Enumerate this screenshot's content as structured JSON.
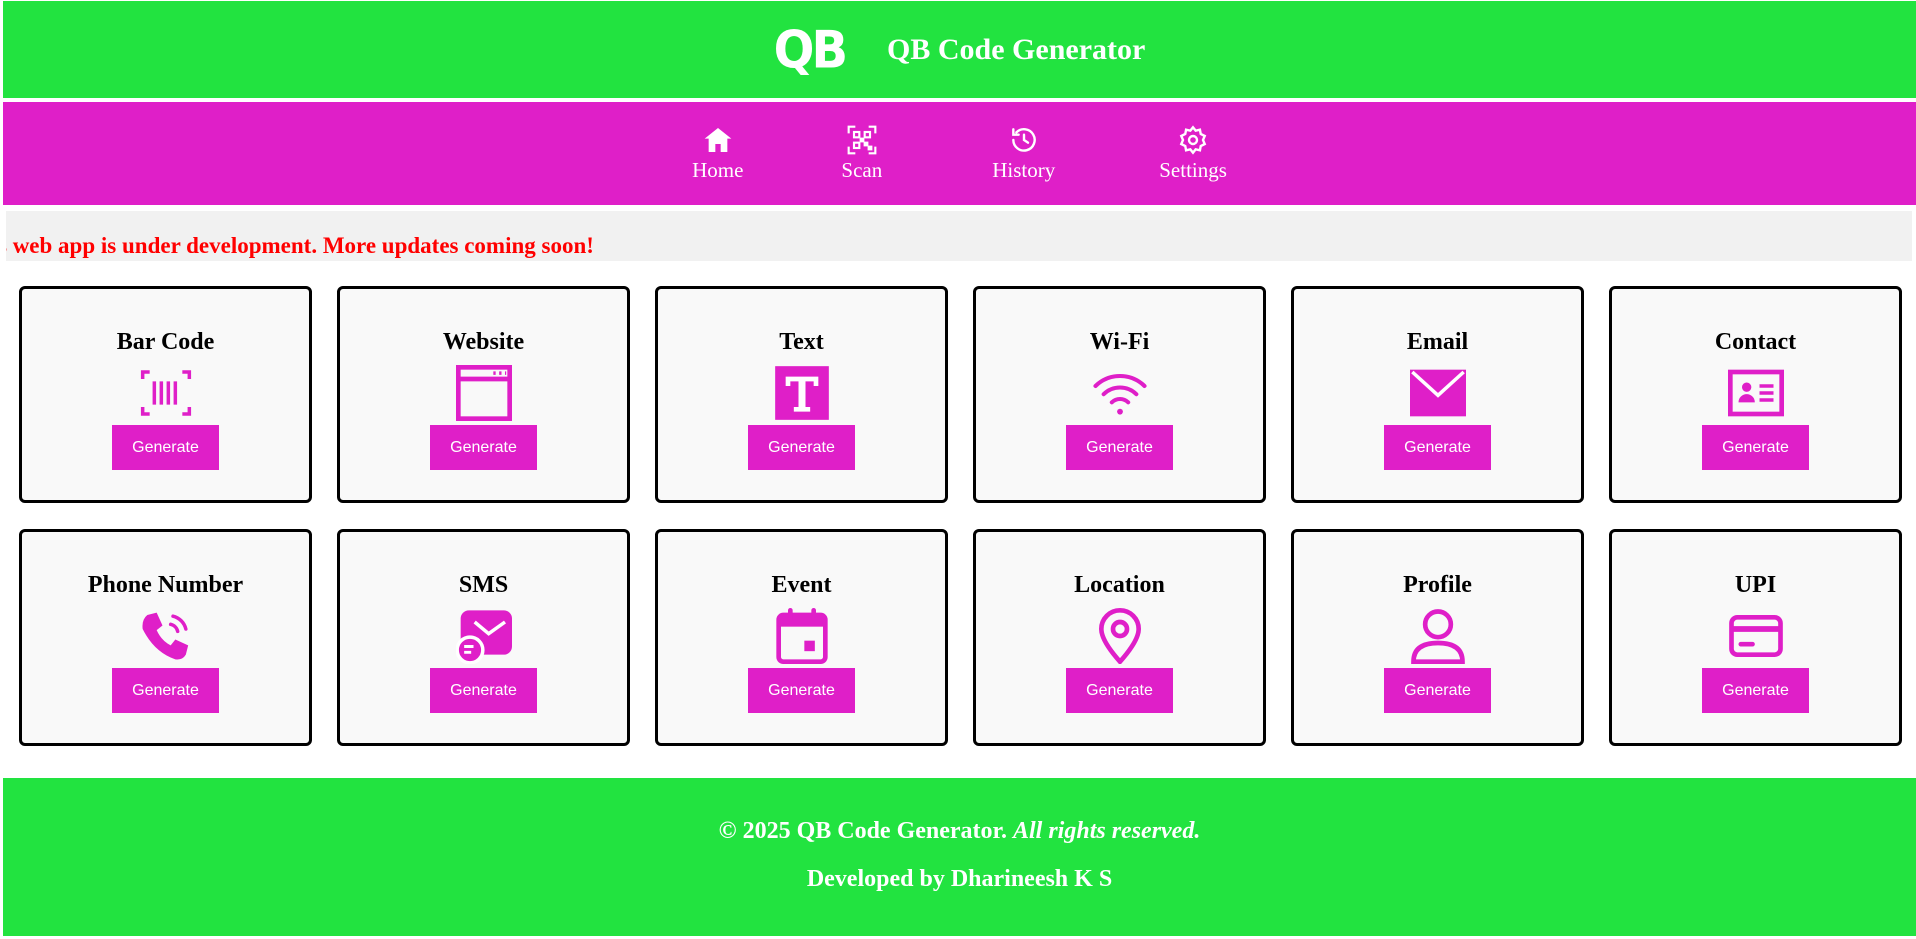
{
  "header": {
    "logo": "QB",
    "title": "QB Code Generator",
    "bg_color": "#22e340"
  },
  "nav": {
    "bg_color": "#df1fc8",
    "items": [
      {
        "label": "Home",
        "icon": "home-icon"
      },
      {
        "label": "Scan",
        "icon": "qr-scan-icon"
      },
      {
        "label": "History",
        "icon": "history-icon"
      },
      {
        "label": "Settings",
        "icon": "gear-icon"
      }
    ]
  },
  "marquee": {
    "text": "s web app is under development. More updates coming soon!",
    "color": "#ff0000"
  },
  "cards": [
    {
      "title": "Bar Code",
      "icon": "barcode-icon",
      "button": "Generate"
    },
    {
      "title": "Website",
      "icon": "browser-window-icon",
      "button": "Generate"
    },
    {
      "title": "Text",
      "icon": "text-icon",
      "button": "Generate"
    },
    {
      "title": "Wi-Fi",
      "icon": "wifi-icon",
      "button": "Generate"
    },
    {
      "title": "Email",
      "icon": "envelope-icon",
      "button": "Generate"
    },
    {
      "title": "Contact",
      "icon": "contact-card-icon",
      "button": "Generate"
    },
    {
      "title": "Phone Number",
      "icon": "phone-icon",
      "button": "Generate"
    },
    {
      "title": "SMS",
      "icon": "sms-icon",
      "button": "Generate"
    },
    {
      "title": "Event",
      "icon": "calendar-icon",
      "button": "Generate"
    },
    {
      "title": "Location",
      "icon": "location-pin-icon",
      "button": "Generate"
    },
    {
      "title": "Profile",
      "icon": "user-profile-icon",
      "button": "Generate"
    },
    {
      "title": "UPI",
      "icon": "credit-card-icon",
      "button": "Generate"
    }
  ],
  "accent_color": "#df1fc8",
  "footer": {
    "copyright": "© 2025 QB Code Generator.",
    "rights": "All rights reserved.",
    "developer": "Developed by Dharineesh K S"
  }
}
